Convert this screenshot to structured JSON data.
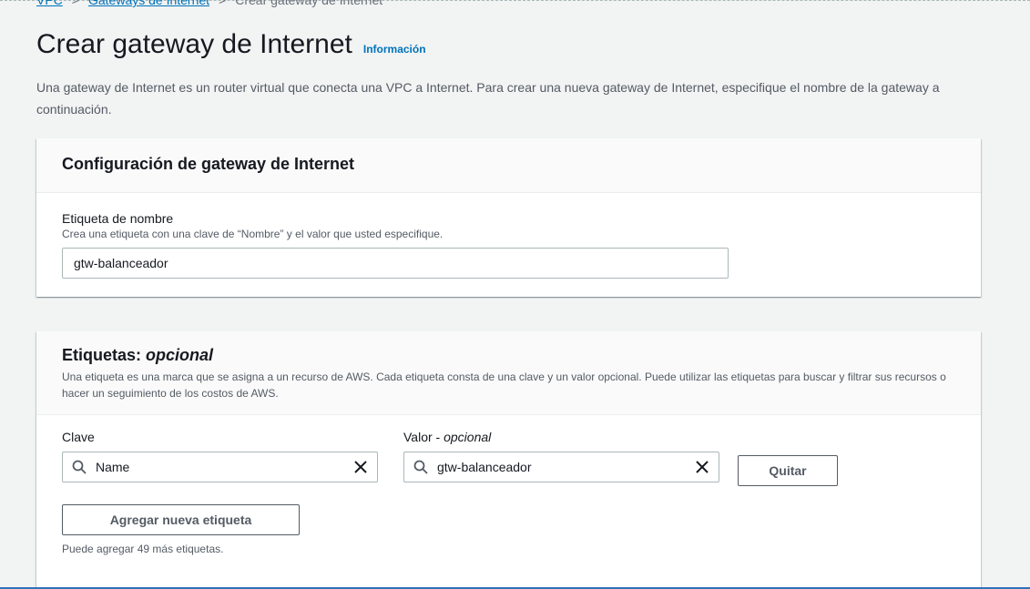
{
  "breadcrumb": {
    "items": [
      "VPC",
      "Gateways de Internet",
      "Crear gateway de Internet"
    ]
  },
  "page": {
    "title": "Crear gateway de Internet",
    "info_link": "Información",
    "description": "Una gateway de Internet es un router virtual que conecta una VPC a Internet. Para crear una nueva gateway de Internet, especifique el nombre de la gateway a continuación."
  },
  "config_card": {
    "title": "Configuración de gateway de Internet",
    "name_label": "Etiqueta de nombre",
    "name_desc": "Crea una etiqueta con una clave de “Nombre” y el valor que usted especifique.",
    "name_value": "gtw-balanceador"
  },
  "tags_card": {
    "title_prefix": "Etiquetas:",
    "title_optional": "opcional",
    "description": "Una etiqueta es una marca que se asigna a un recurso de AWS. Cada etiqueta consta de una clave y un valor opcional. Puede utilizar las etiquetas para buscar y filtrar sus recursos o hacer un seguimiento de los costos de AWS.",
    "key_label": "Clave",
    "value_label_prefix": "Valor -",
    "value_label_optional": "opcional",
    "key_value": "Name",
    "value_value": "gtw-balanceador",
    "remove_label": "Quitar",
    "add_label": "Agregar nueva etiqueta",
    "hint": "Puede agregar 49 más etiquetas."
  },
  "icons": {
    "search": "search-icon",
    "clear": "close-icon"
  },
  "colors": {
    "link": "#0073bb",
    "background": "#f2f3f3",
    "text": "#16191f"
  }
}
